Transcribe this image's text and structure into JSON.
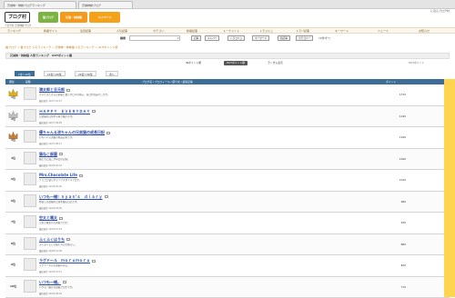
{
  "browser": {
    "tabs": [
      {
        "label": "兄弟姉・姉妹ブログランキング"
      },
      {
        "label": "兄弟姉妹ブログ"
      }
    ]
  },
  "header": {
    "logo": "ブログ村",
    "tagline": "ブログ村 兄弟姉妹ブログ",
    "brand": {
      "seg1": "猫ブログ",
      "seg2": "兄弟・姉妹編",
      "seg3": "マイページ"
    },
    "top_links": "にほんブログ村"
  },
  "nav": {
    "items": [
      "ランキング",
      "新着サイト",
      "注目記事",
      "人気記事",
      "カテゴリ",
      "新着記事",
      "トーナメント",
      "トラコミュ",
      "トラバ記事",
      "キーワード",
      "ニュース",
      "お知らせ"
    ]
  },
  "search": {
    "label": "検索",
    "placeholder": "",
    "buttons": [
      "記事",
      "メンバー",
      "トラコミュ",
      "キーワード",
      "新記事",
      "カテゴリー"
    ],
    "extra": "10件ずつ"
  },
  "breadcrumb": "猫ブログ > 猫ブログ 人気ランキング > 兄弟姉・姉妹猫 人気ランキング > OUTポイント順",
  "page_heading": "兄弟姉・姉妹猫 人気ランキング　OUTポイント順",
  "sort": {
    "items": [
      "INポイント順",
      "OUTポイント順",
      "ランダム表示"
    ],
    "active": 1,
    "right_note": "OUTポイント"
  },
  "ranges": {
    "items": [
      "1位〜10位",
      "11位〜20位",
      "21位〜30位",
      "次へ"
    ],
    "active": 0
  },
  "table": {
    "headers": {
      "rank": "順位",
      "icon": "画像",
      "title": "ブログ名 / プロフィール / 紹介文 / 最新記事",
      "pts": "ポイント"
    }
  },
  "rows": [
    {
      "rank": "1位",
      "title": "満太郎と旦元郎",
      "desc": "さいたまとまる兄弟猫と暮らす日々の様子。毎日をお届けします。",
      "upd": "最終更新 12/27 10:37",
      "pts": "1370"
    },
    {
      "rank": "2位",
      "title": "ＨＡＰＰＹ　ＥＶＥＲＹＤＡＹ",
      "desc": "兄弟猫の日常を写真で綴ります。",
      "upd": "最終更新 12/27 09:05",
      "pts": "1240"
    },
    {
      "rank": "3位",
      "title": "優ちゃん＆涼ちゃんの兄弟猫の成長日記",
      "desc": "かわいい兄弟猫の成長記録です。",
      "upd": "最終更新 12/27 08:11",
      "pts": "1190"
    },
    {
      "rank": "4位",
      "title": "猫ねこ部屋",
      "desc": "猫たちと過ごす毎日の記録。",
      "upd": "最終更新 12/26 22:14",
      "pts": "1090"
    },
    {
      "rank": "5位",
      "title": "Mrs.Chocolate Life",
      "desc": "チョコと暮らすライフスタイルブログ。",
      "upd": "最終更新 12/26 20:02",
      "pts": "1010"
    },
    {
      "rank": "6位",
      "title": "いつも一緒！ｎｙａｎ’ｓ　ｄｉａｒｙ",
      "desc": "仲良し兄弟猫の日常を綴る日記です。",
      "upd": "最終更新 12/26 18:30",
      "pts": "980"
    },
    {
      "rank": "7位",
      "title": "空太と颯太",
      "desc": "空太と颯太の兄弟猫ブログ。",
      "upd": "最終更新 12/26 15:44",
      "pts": "930"
    },
    {
      "rank": "8位",
      "title": "ふくふくはうち",
      "desc": "ふくふくとした猫たちとの暮らし。",
      "upd": "最終更新 12/26 12:09",
      "pts": "880"
    },
    {
      "rank": "9位",
      "title": "ラグドール　ｍｏｒｕｍｏｒｕ",
      "desc": "ラグドールの兄弟猫の毎日。",
      "upd": "最終更新 12/26 10:51",
      "pts": "820"
    },
    {
      "rank": "10位",
      "title": "いつも一緒。",
      "desc": "いつも一緒の兄弟猫ブログです。",
      "upd": "最終更新 12/26 09:03",
      "pts": "770"
    }
  ],
  "colors": {
    "accent": "#3c6e98",
    "brand_orange": "#f39a1c",
    "brand_green": "#7cb342",
    "highlight": "#ffd54f"
  }
}
